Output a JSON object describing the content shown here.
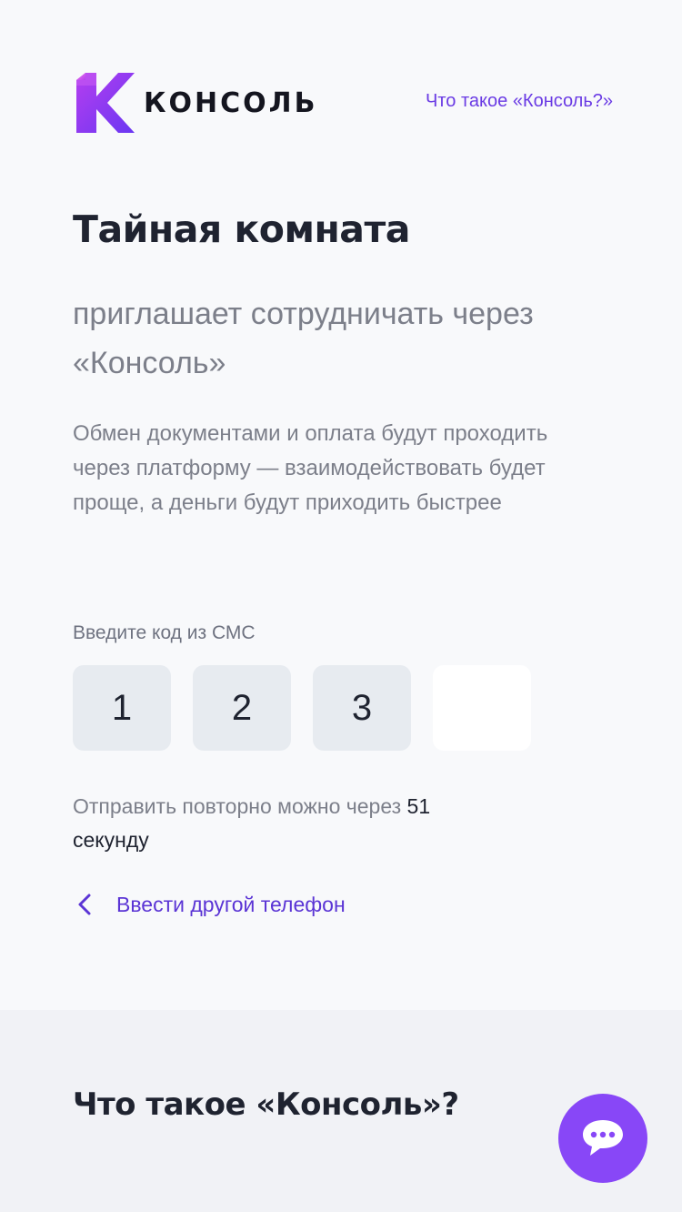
{
  "header": {
    "logo_text": "КОНСОЛЬ",
    "help_link": "Что такое «Консоль?»"
  },
  "main": {
    "title": "Тайная комната",
    "subtitle": "приглашает сотрудничать через «Консоль»",
    "description": "Обмен документами и оплата будут проходить через платформу — взаимодействовать будет проще, а деньги будут приходить быстрее",
    "code_label": "Введите код из СМС",
    "code_digits": [
      "1",
      "2",
      "3",
      ""
    ],
    "resend_prefix": "Отправить повторно можно через",
    "resend_countdown": "51 секунду",
    "change_phone_label": "Ввести другой телефон"
  },
  "footer": {
    "title": "Что такое «Консоль»?"
  },
  "colors": {
    "accent": "#6a3be4",
    "chat_button": "#8847f7",
    "code_box_filled": "#e7ebf0",
    "code_box_empty": "#ffffff"
  },
  "icons": {
    "logo": "konsol-logo-icon",
    "back": "chevron-left-icon",
    "chat": "chat-bubble-icon"
  }
}
